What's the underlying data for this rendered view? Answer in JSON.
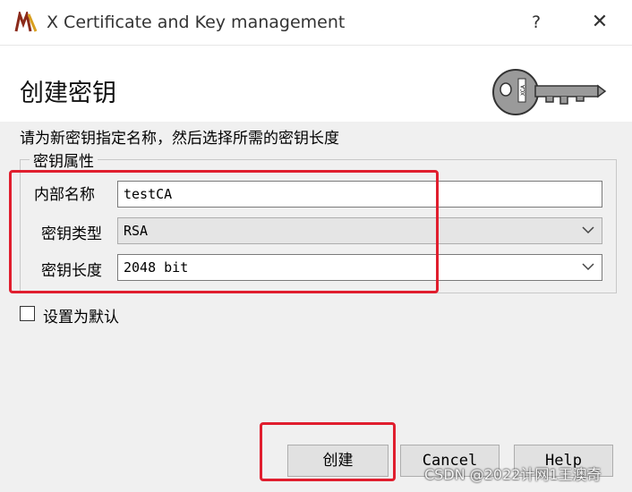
{
  "window": {
    "title": "X Certificate and Key management",
    "help_symbol": "?",
    "close_symbol": "✕"
  },
  "header": {
    "title": "创建密钥"
  },
  "instruction": "请为新密钥指定名称，然后选择所需的密钥长度",
  "group": {
    "title": "密钥属性",
    "name_label": "内部名称",
    "name_value": "testCA",
    "type_label": "密钥类型",
    "type_value": "RSA",
    "length_label": "密钥长度",
    "length_value": "2048 bit"
  },
  "default_checkbox": {
    "label": "设置为默认",
    "checked": false
  },
  "buttons": {
    "create": "创建",
    "cancel": "Cancel",
    "help": "Help"
  },
  "watermark": "CSDN @2022计网1王澳奇",
  "colors": {
    "highlight": "#e01e2e"
  },
  "icons": {
    "app": "xca-app-icon",
    "header": "key-icon"
  }
}
